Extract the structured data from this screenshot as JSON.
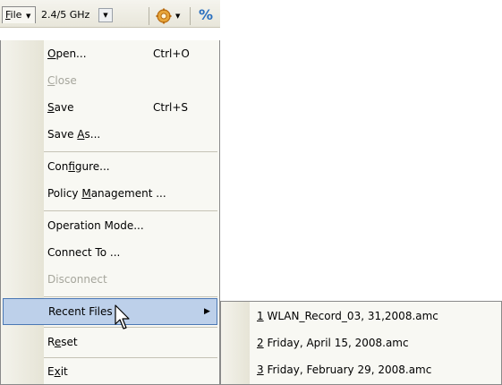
{
  "toolbar": {
    "file_menu": {
      "label": "File",
      "mnemonic": "F",
      "rest": "ile"
    },
    "band_selector": {
      "value": "2.4/5 GHz"
    },
    "settings_icon": "gear-icon",
    "percent_icon_label": "%"
  },
  "file_menu": {
    "items": [
      {
        "pre": "",
        "mnemonic": "O",
        "post": "pen...",
        "shortcut": "Ctrl+O",
        "enabled": true
      },
      {
        "pre": "",
        "mnemonic": "C",
        "post": "lose",
        "shortcut": "",
        "enabled": false
      },
      {
        "pre": "",
        "mnemonic": "S",
        "post": "ave",
        "shortcut": "Ctrl+S",
        "enabled": true
      },
      {
        "pre": "Save ",
        "mnemonic": "A",
        "post": "s...",
        "shortcut": "",
        "enabled": true
      },
      {
        "pre": "Con",
        "mnemonic": "f",
        "post": "igure...",
        "shortcut": "",
        "enabled": true
      },
      {
        "pre": "Policy ",
        "mnemonic": "M",
        "post": "anagement ...",
        "shortcut": "",
        "enabled": true
      },
      {
        "pre": "Operation Mode...",
        "mnemonic": "",
        "post": "",
        "shortcut": "",
        "enabled": true
      },
      {
        "pre": "Connect To ...",
        "mnemonic": "",
        "post": "",
        "shortcut": "",
        "enabled": true
      },
      {
        "pre": "Disconnect",
        "mnemonic": "",
        "post": "",
        "shortcut": "",
        "enabled": false
      },
      {
        "pre": "Recent Files",
        "mnemonic": "",
        "post": "",
        "shortcut": "",
        "enabled": true,
        "has_submenu": true,
        "highlighted": true
      },
      {
        "pre": "R",
        "mnemonic": "e",
        "post": "set",
        "shortcut": "",
        "enabled": true
      },
      {
        "pre": "E",
        "mnemonic": "x",
        "post": "it",
        "shortcut": "",
        "enabled": true
      }
    ]
  },
  "recent_files": {
    "items": [
      {
        "num": "1",
        "name": " WLAN_Record_03, 31,2008.amc"
      },
      {
        "num": "2",
        "name": " Friday, April 15, 2008.amc"
      },
      {
        "num": "3",
        "name": " Friday, February 29, 2008.amc"
      }
    ]
  }
}
